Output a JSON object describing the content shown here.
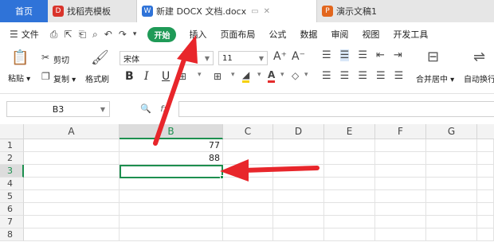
{
  "tabs": {
    "home": "首页",
    "items": [
      {
        "label": "找稻壳模板",
        "icon": "D",
        "color": "#d9342b"
      },
      {
        "label": "新建 DOCX 文档.docx",
        "icon": "W",
        "color": "#2f73d8",
        "active": true
      },
      {
        "label": "演示文稿1",
        "icon": "P",
        "color": "#e2661d"
      }
    ]
  },
  "menu": {
    "file": "文件",
    "start": "开始",
    "items": [
      "插入",
      "页面布局",
      "公式",
      "数据",
      "审阅",
      "视图",
      "开发工具"
    ]
  },
  "ribbon": {
    "paste": "粘贴",
    "cut": "剪切",
    "copy": "复制",
    "format_painter": "格式刷",
    "font_name": "宋体",
    "font_size": "11",
    "bold": "B",
    "italic": "I",
    "underline": "U",
    "grow": "A⁺",
    "shrink": "A⁻",
    "merge": "合并居中",
    "wrap": "自动换行"
  },
  "formula": {
    "cell_ref": "B3",
    "fx": "fx"
  },
  "grid": {
    "columns": [
      "A",
      "B",
      "C",
      "D",
      "E",
      "F",
      "G"
    ],
    "rows": [
      "1",
      "2",
      "3",
      "4",
      "5",
      "6",
      "7",
      "8"
    ],
    "cells": {
      "B1": "77",
      "B2": "88"
    },
    "selected": "B3"
  },
  "colors": {
    "accent": "#1d8f4f",
    "annotation": "#e8262b",
    "tab_active": "#2f73d8"
  }
}
